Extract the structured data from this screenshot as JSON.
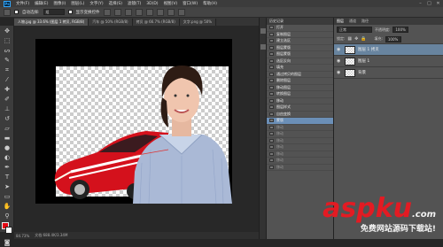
{
  "app": {
    "logo": "Ps"
  },
  "menu": [
    "文件(F)",
    "编辑(E)",
    "图像(I)",
    "图层(L)",
    "文字(Y)",
    "选择(S)",
    "滤镜(T)",
    "3D(D)",
    "视图(V)",
    "窗口(W)",
    "帮助(H)"
  ],
  "options": {
    "mode_label": "自动选择:",
    "mode_value": "组",
    "show_transform": "显示变换控件"
  },
  "tabs": [
    "人物.jpg @ 33.6% (图层 1 拷贝, RGB/8)",
    "汽车 @ 50% (RGB/8)",
    "拷贝 @ 66.7% (RGB/8)",
    "文字.png @ 50%"
  ],
  "status": {
    "zoom": "84.73%",
    "doc": "文档:688.4K/3.34M"
  },
  "history": {
    "tab": "历史记录",
    "items": [
      {
        "label": "打开",
        "state": "normal"
      },
      {
        "label": "复制图层",
        "state": "normal"
      },
      {
        "label": "建立选区",
        "state": "normal"
      },
      {
        "label": "图层蒙版",
        "state": "normal"
      },
      {
        "label": "图层蒙版",
        "state": "normal"
      },
      {
        "label": "选区反向",
        "state": "normal"
      },
      {
        "label": "填充",
        "state": "normal"
      },
      {
        "label": "通过拷贝的图层",
        "state": "normal"
      },
      {
        "label": "删除图层",
        "state": "normal"
      },
      {
        "label": "移动图层",
        "state": "normal"
      },
      {
        "label": "转换图层",
        "state": "normal"
      },
      {
        "label": "移动",
        "state": "normal"
      },
      {
        "label": "图层样式",
        "state": "normal"
      },
      {
        "label": "自由变换",
        "state": "normal"
      },
      {
        "label": "蒙版",
        "state": "selected"
      },
      {
        "label": "移动",
        "state": "dim"
      },
      {
        "label": "移动",
        "state": "dim"
      },
      {
        "label": "移动",
        "state": "dim"
      },
      {
        "label": "移动",
        "state": "dim"
      },
      {
        "label": "移动",
        "state": "dim"
      },
      {
        "label": "移动",
        "state": "dim"
      },
      {
        "label": "移动",
        "state": "dim"
      }
    ]
  },
  "layers": {
    "tabs": [
      "图层",
      "通道",
      "路径"
    ],
    "blend": "正常",
    "opacity_label": "不透明度:",
    "opacity": "100%",
    "lock_label": "锁定:",
    "fill_label": "填充:",
    "fill": "100%",
    "items": [
      {
        "name": "图层 1 拷贝",
        "selected": true
      },
      {
        "name": "图层 1",
        "selected": false
      },
      {
        "name": "背景",
        "selected": false
      }
    ]
  },
  "watermark": {
    "brand": "aspku",
    "tld": ".com",
    "tagline": "免费网站源码下载站!"
  }
}
